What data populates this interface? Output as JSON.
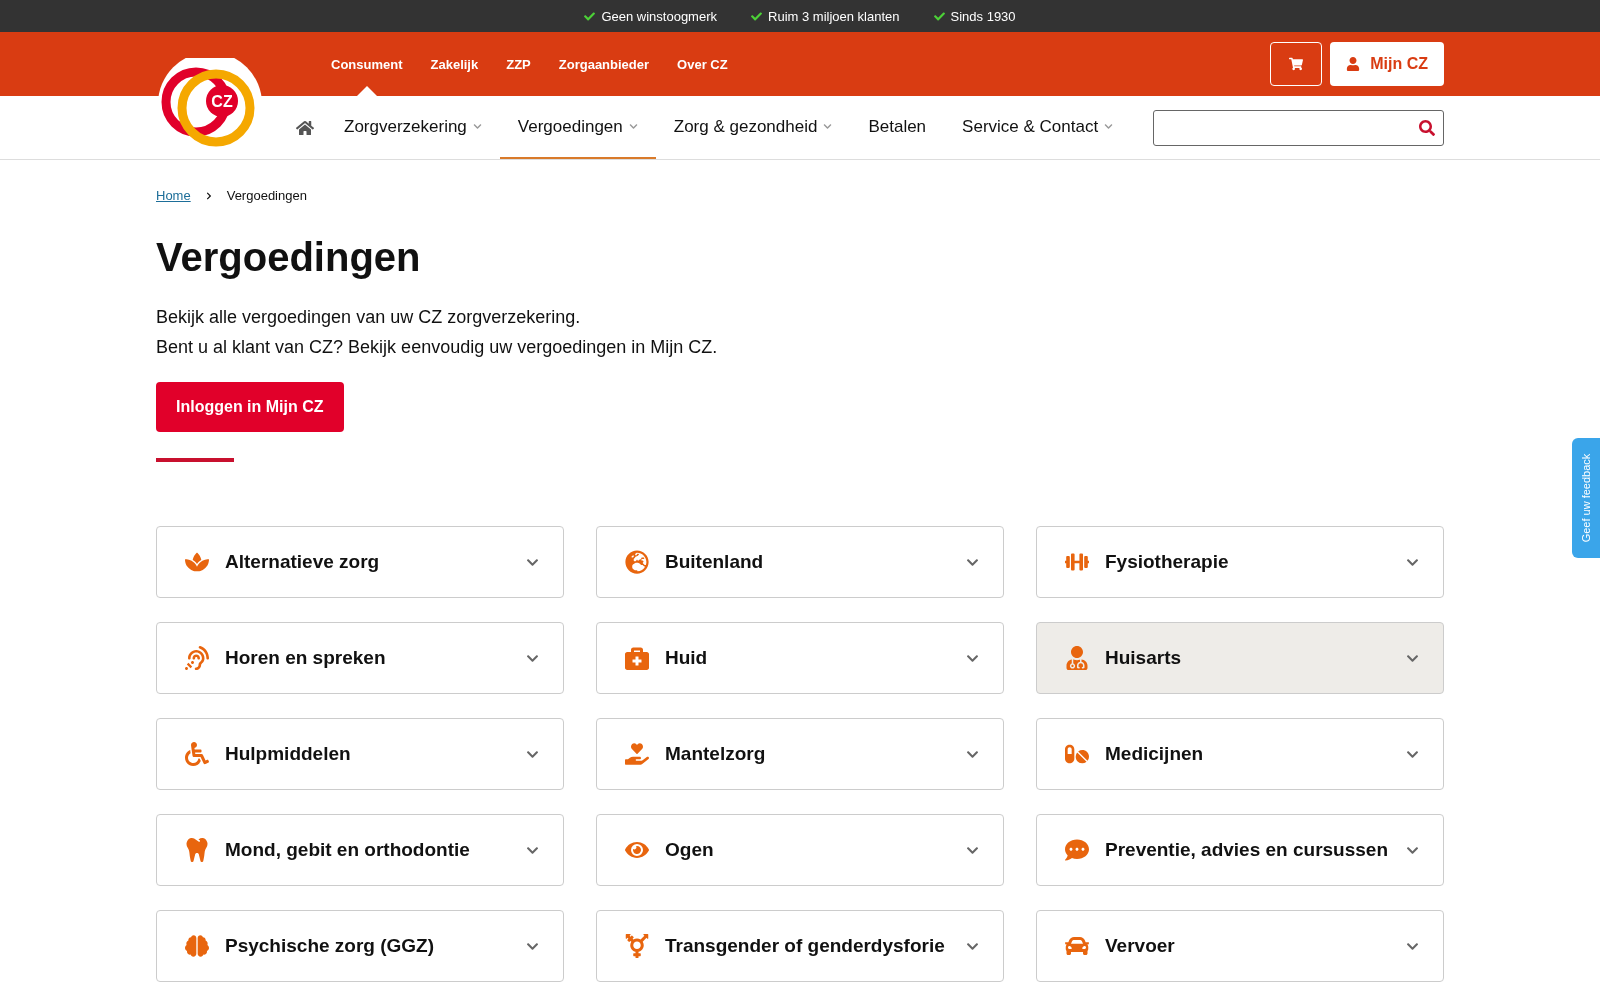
{
  "usps": [
    "Geen winstoogmerk",
    "Ruim 3 miljoen klanten",
    "Sinds 1930"
  ],
  "logo": {
    "text": "CZ"
  },
  "audience_tabs": [
    {
      "label": "Consument",
      "selected": true
    },
    {
      "label": "Zakelijk",
      "selected": false
    },
    {
      "label": "ZZP",
      "selected": false
    },
    {
      "label": "Zorgaanbieder",
      "selected": false
    },
    {
      "label": "Over CZ",
      "selected": false
    }
  ],
  "account_button": "Mijn CZ",
  "nav": [
    {
      "label": "Zorgverzekering",
      "dropdown": true,
      "selected": false
    },
    {
      "label": "Vergoedingen",
      "dropdown": true,
      "selected": true
    },
    {
      "label": "Zorg & gezondheid",
      "dropdown": true,
      "selected": false
    },
    {
      "label": "Betalen",
      "dropdown": false,
      "selected": false
    },
    {
      "label": "Service & Contact",
      "dropdown": true,
      "selected": false
    }
  ],
  "breadcrumb": [
    {
      "label": "Home",
      "link": true
    },
    {
      "label": "Vergoedingen",
      "link": false
    }
  ],
  "title": "Vergoedingen",
  "intro": [
    "Bekijk alle vergoedingen van uw CZ zorgverzekering.",
    "Bent u al klant van CZ? Bekijk eenvoudig uw vergoedingen in Mijn CZ."
  ],
  "login_button": "Inloggen in Mijn CZ",
  "categories": [
    {
      "label": "Alternatieve zorg",
      "highlighted": false
    },
    {
      "label": "Buitenland",
      "highlighted": false
    },
    {
      "label": "Fysiotherapie",
      "highlighted": false
    },
    {
      "label": "Horen en spreken",
      "highlighted": false
    },
    {
      "label": "Huid",
      "highlighted": false
    },
    {
      "label": "Huisarts",
      "highlighted": true
    },
    {
      "label": "Hulpmiddelen",
      "highlighted": false
    },
    {
      "label": "Mantelzorg",
      "highlighted": false
    },
    {
      "label": "Medicijnen",
      "highlighted": false
    },
    {
      "label": "Mond, gebit en orthodontie",
      "highlighted": false
    },
    {
      "label": "Ogen",
      "highlighted": false
    },
    {
      "label": "Preventie, advies en cursussen",
      "highlighted": false
    },
    {
      "label": "Psychische zorg (GGZ)",
      "highlighted": false
    },
    {
      "label": "Transgender of genderdysforie",
      "highlighted": false
    },
    {
      "label": "Vervoer",
      "highlighted": false
    }
  ],
  "feedback_tab": "Geef uw feedback"
}
